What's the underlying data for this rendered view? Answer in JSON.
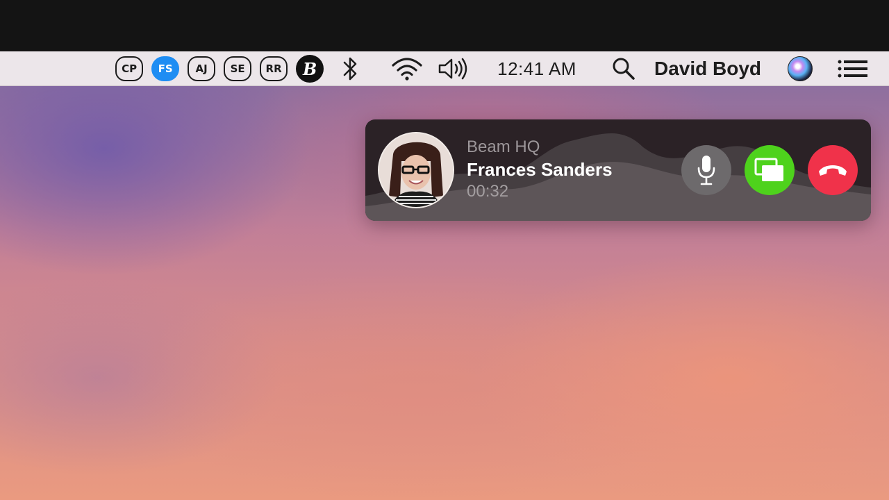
{
  "menubar": {
    "initials": [
      {
        "label": "CP",
        "active": false
      },
      {
        "label": "FS",
        "active": true
      },
      {
        "label": "AJ",
        "active": false
      },
      {
        "label": "SE",
        "active": false
      },
      {
        "label": "RR",
        "active": false
      }
    ],
    "beam_logo": "B",
    "icons": [
      "bluetooth-icon",
      "wifi-icon",
      "volume-icon",
      "search-icon",
      "siri-icon",
      "menu-list-icon"
    ],
    "time": "12:41 AM",
    "user": "David Boyd"
  },
  "call": {
    "group": "Beam HQ",
    "caller": "Frances Sanders",
    "duration": "00:32",
    "buttons": {
      "mute": "mic-icon",
      "screen_share": "screen-share-icon",
      "hang_up": "hang-up-icon"
    }
  },
  "colors": {
    "active_badge": "#1e8df3",
    "share_button": "#4ed21c",
    "end_button": "#f0324a",
    "mic_button": "#6d6a6c"
  }
}
